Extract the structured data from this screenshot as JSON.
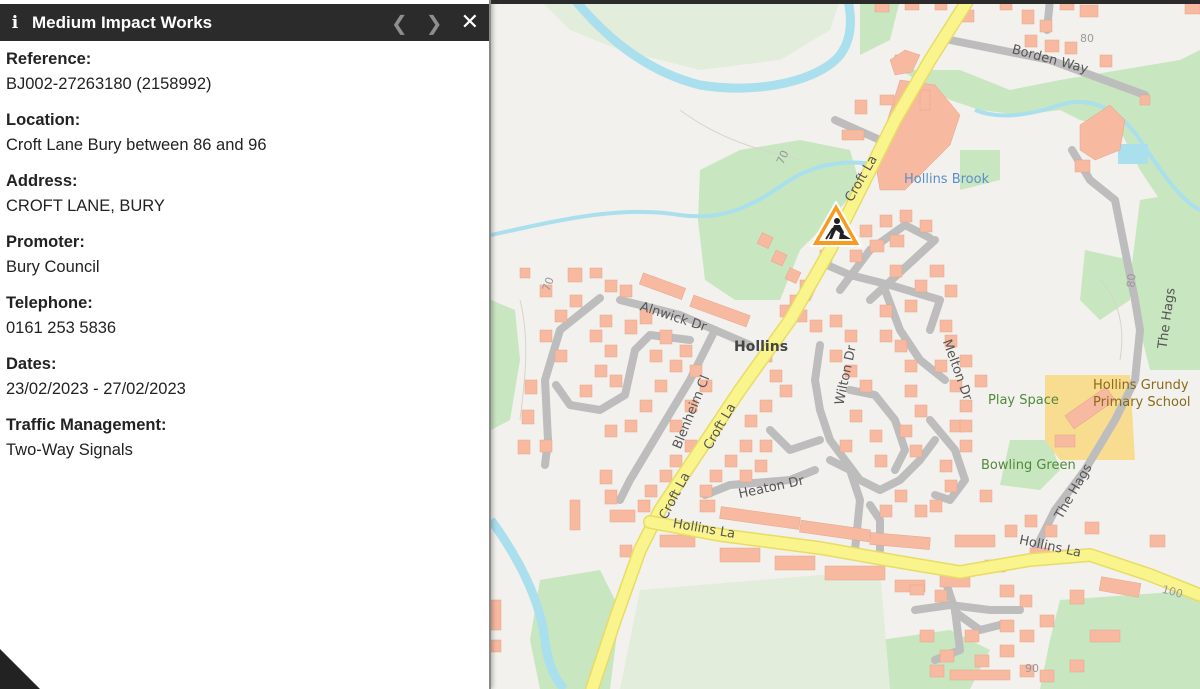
{
  "panel": {
    "title": "Medium Impact Works",
    "info_icon": "info-icon",
    "controls": {
      "prev_icon": "chevron-left-icon",
      "next_icon": "chevron-right-icon",
      "close_icon": "close-icon"
    },
    "fields": [
      {
        "label": "Reference:",
        "value": "BJ002-27263180 (2158992)"
      },
      {
        "label": "Location:",
        "value": "Croft Lane Bury between 86 and 96"
      },
      {
        "label": "Address:",
        "value": "CROFT LANE, BURY"
      },
      {
        "label": "Promoter:",
        "value": "Bury Council"
      },
      {
        "label": "Telephone:",
        "value": "0161 253 5836"
      },
      {
        "label": "Dates:",
        "value": "23/02/2023 - 27/02/2023"
      },
      {
        "label": "Traffic Management:",
        "value": "Two-Way Signals"
      }
    ]
  },
  "map": {
    "marker_icon": "roadworks-icon",
    "labels": {
      "borden_way": "Borden Way",
      "hollins_brook": "Hollins Brook",
      "croft_la_1": "Croft La",
      "croft_la_2": "Croft La",
      "croft_la_3": "Croft La",
      "alnwick_dr": "Alnwick Dr",
      "hollins": "Hollins",
      "blenheim_cl": "Blenheim Cl",
      "wilton_dr": "Wilton Dr",
      "melton_dr": "Melton Dr",
      "heaton_dr": "Heaton Dr",
      "hollins_la_1": "Hollins La",
      "hollins_la_2": "Hollins La",
      "the_hags_1": "The Hags",
      "the_hags_2": "The Hags",
      "play_space": "Play Space",
      "bowling_green": "Bowling Green",
      "school_1": "Hollins Grundy",
      "school_2": "Primary School",
      "contour_70a": "70",
      "contour_70b": "70",
      "contour_80a": "80",
      "contour_80b": "80",
      "contour_90": "90",
      "contour_100": "100"
    },
    "colors": {
      "background": "#f2f1ed",
      "green": "#c8e6c0",
      "water": "#aadfee",
      "building": "#f7b9a0",
      "main_road": "#faf48c",
      "minor_road": "#cfcfcf",
      "school": "#f8dc90"
    }
  }
}
